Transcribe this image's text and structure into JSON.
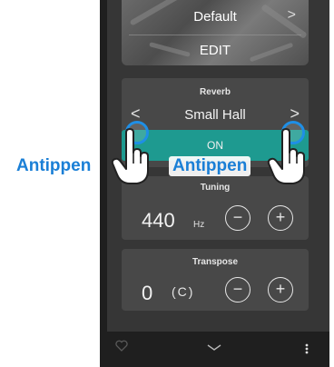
{
  "preset": {
    "name": "Default",
    "next_arrow": ">",
    "edit_label": "EDIT"
  },
  "reverb": {
    "title": "Reverb",
    "value": "Small Hall",
    "prev_arrow": "<",
    "next_arrow": ">",
    "toggle_label": "ON"
  },
  "tuning": {
    "title": "Tuning",
    "value": "440",
    "unit": "Hz",
    "minus": "−",
    "plus": "+"
  },
  "transpose": {
    "title": "Transpose",
    "value": "0",
    "note": "(C)",
    "minus": "−",
    "plus": "+"
  },
  "callouts": {
    "left": "Antippen",
    "right": "Antippen"
  },
  "bottom_bar": {
    "icons": [
      "heart-icon",
      "chevron-down-icon",
      "more-vertical-icon"
    ]
  },
  "colors": {
    "accent_teal": "#1e9a90",
    "callout_blue": "#1a7fd6",
    "tap_ring": "#1f8fe6"
  }
}
